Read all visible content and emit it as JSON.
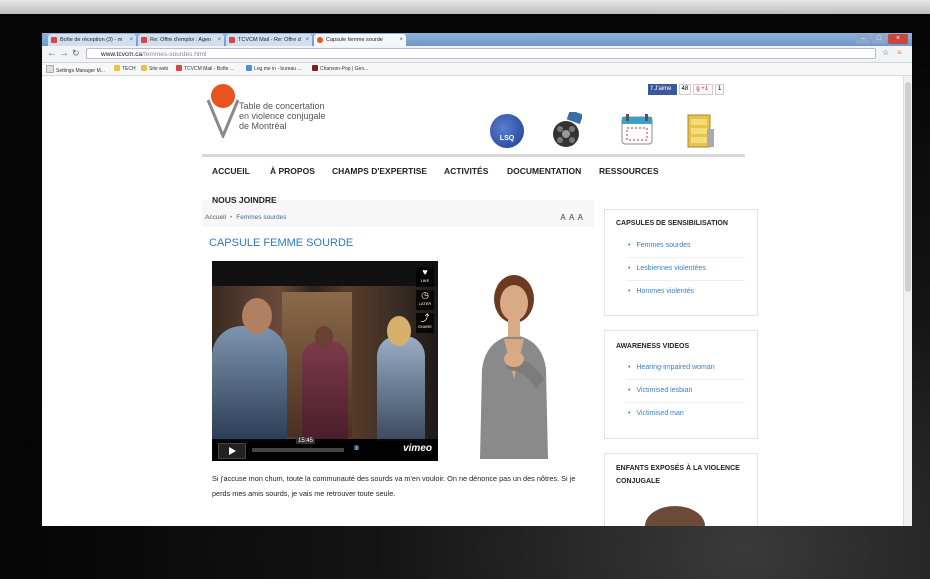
{
  "browser": {
    "tabs": [
      {
        "label": "Boîte de réception (3) - m",
        "active": false
      },
      {
        "label": "Re: Offre d'emploi : Agen",
        "active": false
      },
      {
        "label": "TCVCM Mail - Re: Offre d",
        "active": false
      },
      {
        "label": "Capsule femme sourde",
        "active": true
      }
    ],
    "url_domain": "www.tcvcm.ca",
    "url_path": "/femmes-sourdes.html",
    "bookmarks": [
      "Settings Manager M...",
      "TECH",
      "Site web",
      "TCVCM Mail - Boîte ...",
      "Log me in - bureau ...",
      "Chanson-Pop | Gen..."
    ]
  },
  "site": {
    "logo_lines": [
      "Table de concertation",
      "en violence conjugale",
      "de Montréal"
    ],
    "social": {
      "like_label": "J'aime",
      "like_count": "48",
      "gplus_label": "+1",
      "gplus_count": "1"
    },
    "lsq_label": "LSQ",
    "nav": [
      "ACCUEIL",
      "À PROPOS",
      "CHAMPS D'EXPERTISE",
      "ACTIVITÉS",
      "DOCUMENTATION",
      "RESSOURCES",
      "NOUS JOINDRE"
    ]
  },
  "breadcrumb": {
    "home": "Accueil",
    "sep": "•",
    "current": "Femmes sourdes"
  },
  "text_size": "A A A",
  "article": {
    "title": "CAPSULE FEMME SOURDE",
    "video": {
      "time": "15:45",
      "brand": "vimeo",
      "side_like": "LIKE",
      "side_later": "LATER",
      "side_share": "SHARE",
      "hd": "IIIIII"
    },
    "paragraph": "Si j'accuse mon chum, toute la communauté des sourds va m'en vouloir. On ne dénonce pas un des nôtres. Si je perds mes amis sourds, je vais me retrouver toute seule."
  },
  "sidebar": {
    "box1": {
      "title": "CAPSULES DE SENSIBILISATION",
      "items": [
        "Femmes sourdes",
        "Lesbiennes violentées",
        "Hommes violentés"
      ]
    },
    "box2": {
      "title": "AWARENESS VIDEOS",
      "items": [
        "Hearing-impaired woman",
        "Victimised lesbian",
        "Victimised man"
      ]
    },
    "box3": {
      "title_line1": "ENFANTS EXPOSÉS À LA VIOLENCE",
      "title_line2": "CONJUGALE"
    }
  },
  "colors": {
    "accent_orange": "#e8531f",
    "link_blue": "#3a7fc0",
    "title_blue": "#2d7ab6"
  }
}
